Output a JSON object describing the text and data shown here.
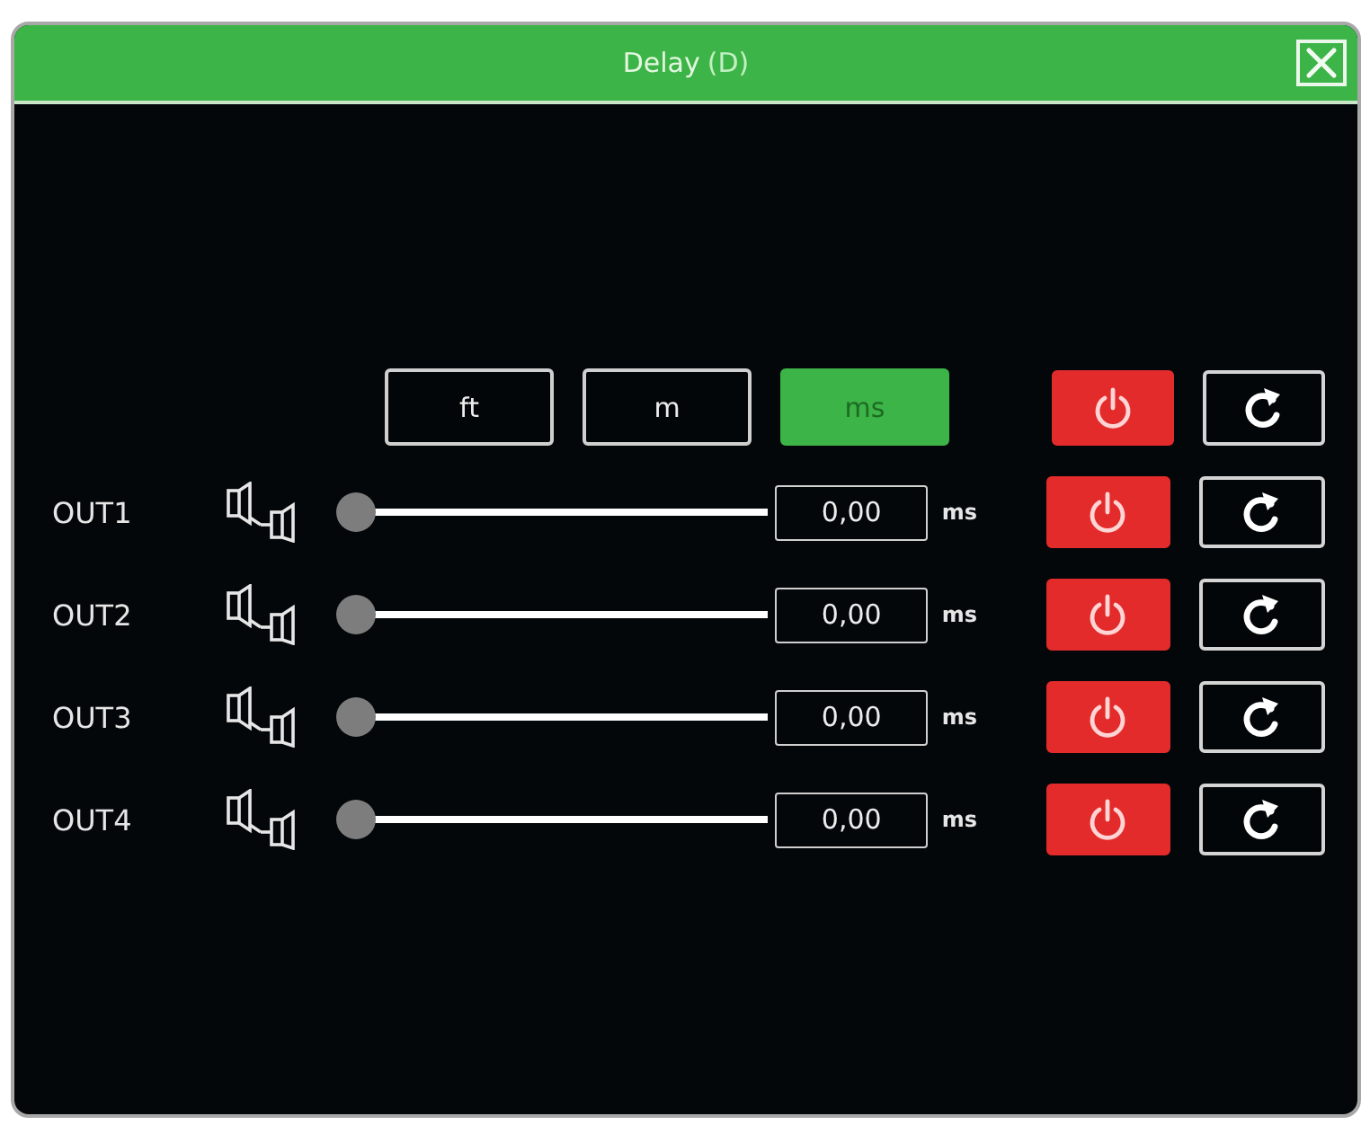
{
  "window": {
    "title": "Delay",
    "shortcut": "(D)"
  },
  "units": [
    {
      "label": "ft",
      "selected": false
    },
    {
      "label": "m",
      "selected": false
    },
    {
      "label": "ms",
      "selected": true
    }
  ],
  "master": {
    "on": true
  },
  "channels": [
    {
      "name": "OUT1",
      "level": 0,
      "value": "0,00",
      "unit": "ms",
      "on": true
    },
    {
      "name": "OUT2",
      "level": 0,
      "value": "0,00",
      "unit": "ms",
      "on": true
    },
    {
      "name": "OUT3",
      "level": 0,
      "value": "0,00",
      "unit": "ms",
      "on": true
    },
    {
      "name": "OUT4",
      "level": 0,
      "value": "0,00",
      "unit": "ms",
      "on": true
    }
  ]
}
